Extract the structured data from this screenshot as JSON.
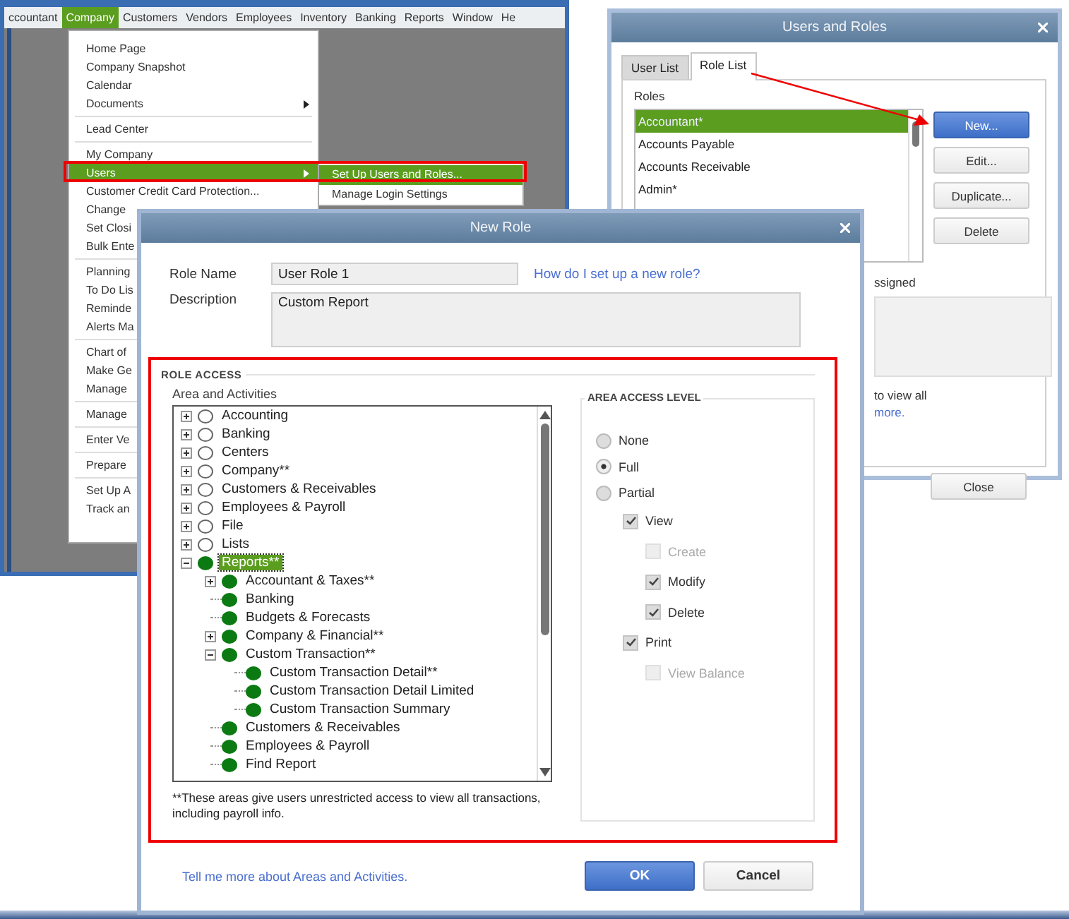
{
  "main_window": {
    "menu_bar": [
      {
        "label": "ccountant",
        "selected": false
      },
      {
        "label": "Company",
        "selected": true
      },
      {
        "label": "Customers",
        "selected": false
      },
      {
        "label": "Vendors",
        "selected": false
      },
      {
        "label": "Employees",
        "selected": false
      },
      {
        "label": "Inventory",
        "selected": false
      },
      {
        "label": "Banking",
        "selected": false
      },
      {
        "label": "Reports",
        "selected": false
      },
      {
        "label": "Window",
        "selected": false
      },
      {
        "label": "He",
        "selected": false
      }
    ]
  },
  "company_menu": {
    "groups": [
      {
        "items": [
          {
            "label": "Home Page",
            "selected": false,
            "submenu": false
          },
          {
            "label": "Company Snapshot",
            "selected": false,
            "submenu": false
          },
          {
            "label": "Calendar",
            "selected": false,
            "submenu": false
          },
          {
            "label": "Documents",
            "selected": false,
            "submenu": true
          }
        ]
      },
      {
        "items": [
          {
            "label": "Lead Center",
            "selected": false,
            "submenu": false
          }
        ]
      },
      {
        "items": [
          {
            "label": "My Company",
            "selected": false,
            "submenu": false
          },
          {
            "label": "Users",
            "selected": true,
            "submenu": true
          },
          {
            "label": "Customer Credit Card Protection...",
            "selected": false,
            "submenu": false
          },
          {
            "label": "Change",
            "selected": false
          },
          {
            "label": "Set Closi",
            "selected": false
          },
          {
            "label": "Bulk Ente",
            "selected": false
          }
        ]
      },
      {
        "items": [
          {
            "label": "Planning",
            "selected": false
          },
          {
            "label": "To Do Lis",
            "selected": false
          },
          {
            "label": "Reminde",
            "selected": false
          },
          {
            "label": "Alerts Ma",
            "selected": false
          }
        ]
      },
      {
        "items": [
          {
            "label": "Chart of",
            "selected": false
          },
          {
            "label": "Make Ge",
            "selected": false
          },
          {
            "label": "Manage",
            "selected": false
          }
        ]
      },
      {
        "items": [
          {
            "label": "Manage",
            "selected": false
          }
        ]
      },
      {
        "items": [
          {
            "label": "Enter Ve",
            "selected": false
          }
        ]
      },
      {
        "items": [
          {
            "label": "Prepare",
            "selected": false
          }
        ]
      },
      {
        "items": [
          {
            "label": "Set Up A",
            "selected": false
          },
          {
            "label": "Track an",
            "selected": false
          }
        ]
      }
    ]
  },
  "users_submenu": {
    "items": [
      {
        "label": "Set Up Users and Roles...",
        "selected": true
      },
      {
        "label": "Manage Login Settings",
        "selected": false
      }
    ]
  },
  "users_and_roles": {
    "title": "Users and Roles",
    "tabs": [
      {
        "label": "User List",
        "selected": false
      },
      {
        "label": "Role List",
        "selected": true
      }
    ],
    "roles_label": "Roles",
    "roles": [
      {
        "label": "Accountant*",
        "selected": true
      },
      {
        "label": "Accounts Payable",
        "selected": false
      },
      {
        "label": "Accounts Receivable",
        "selected": false
      },
      {
        "label": "Admin*",
        "selected": false
      }
    ],
    "buttons": [
      {
        "label": "New...",
        "primary": true
      },
      {
        "label": "Edit...",
        "primary": false
      },
      {
        "label": "Duplicate...",
        "primary": false
      },
      {
        "label": "Delete",
        "primary": false
      }
    ],
    "assigned_label": "ssigned",
    "note": "to view all",
    "more_link": "more.",
    "close_button": "Close"
  },
  "new_role": {
    "title": "New Role",
    "role_name_label": "Role Name",
    "role_name": "User Role 1",
    "help_link": "How do I set up a new role?",
    "description_label": "Description",
    "description": "Custom Report",
    "section_title": "ROLE ACCESS",
    "tree_label": "Area and Activities",
    "tree": [
      {
        "label": "Accounting",
        "kind": "branch",
        "expanded": false,
        "full_access": false,
        "selected": false
      },
      {
        "label": "Banking",
        "kind": "branch",
        "expanded": false,
        "full_access": false,
        "selected": false
      },
      {
        "label": "Centers",
        "kind": "branch",
        "expanded": false,
        "full_access": false,
        "selected": false
      },
      {
        "label": "Company**",
        "kind": "branch",
        "expanded": false,
        "full_access": false,
        "selected": false
      },
      {
        "label": "Customers & Receivables",
        "kind": "branch",
        "expanded": false,
        "full_access": false,
        "selected": false
      },
      {
        "label": "Employees & Payroll",
        "kind": "branch",
        "expanded": false,
        "full_access": false,
        "selected": false
      },
      {
        "label": "File",
        "kind": "branch",
        "expanded": false,
        "full_access": false,
        "selected": false
      },
      {
        "label": "Lists",
        "kind": "branch",
        "expanded": false,
        "full_access": false,
        "selected": false
      },
      {
        "label": "Reports**",
        "kind": "branch",
        "expanded": true,
        "full_access": true,
        "selected": true,
        "children": [
          {
            "label": "Accountant & Taxes**",
            "kind": "branch",
            "expanded": false,
            "full_access": true,
            "selected": false
          },
          {
            "label": "Banking",
            "kind": "leaf",
            "full_access": true,
            "selected": false
          },
          {
            "label": "Budgets & Forecasts",
            "kind": "leaf",
            "full_access": true,
            "selected": false
          },
          {
            "label": "Company & Financial**",
            "kind": "branch",
            "expanded": false,
            "full_access": true,
            "selected": false
          },
          {
            "label": "Custom Transaction**",
            "kind": "branch",
            "expanded": true,
            "full_access": true,
            "selected": false,
            "children": [
              {
                "label": "Custom Transaction Detail**",
                "kind": "leaf",
                "full_access": true,
                "selected": false
              },
              {
                "label": "Custom Transaction Detail Limited",
                "kind": "leaf",
                "full_access": true,
                "selected": false
              },
              {
                "label": "Custom Transaction Summary",
                "kind": "leaf",
                "full_access": true,
                "selected": false
              }
            ]
          },
          {
            "label": "Customers & Receivables",
            "kind": "leaf",
            "full_access": true,
            "selected": false
          },
          {
            "label": "Employees & Payroll",
            "kind": "leaf",
            "full_access": true,
            "selected": false
          },
          {
            "label": "Find Report",
            "kind": "leaf",
            "full_access": true,
            "selected": false
          }
        ]
      }
    ],
    "footnote": "**These areas give users unrestricted access to view all transactions, including payroll info.",
    "access_title": "AREA ACCESS LEVEL",
    "access_levels": [
      {
        "label": "None",
        "selected": false
      },
      {
        "label": "Full",
        "selected": true
      },
      {
        "label": "Partial",
        "selected": false
      }
    ],
    "permissions": [
      {
        "label": "View",
        "checked": true,
        "disabled": false,
        "children": [
          {
            "label": "Create",
            "checked": false,
            "disabled": true
          },
          {
            "label": "Modify",
            "checked": true,
            "disabled": false
          },
          {
            "label": "Delete",
            "checked": true,
            "disabled": false
          }
        ]
      },
      {
        "label": "Print",
        "checked": true,
        "disabled": false,
        "children": [
          {
            "label": "View Balance",
            "checked": false,
            "disabled": true
          }
        ]
      }
    ],
    "more_link": "Tell me more about Areas and Activities.",
    "buttons": [
      {
        "label": "OK",
        "primary": true
      },
      {
        "label": "Cancel",
        "primary": false
      }
    ]
  }
}
